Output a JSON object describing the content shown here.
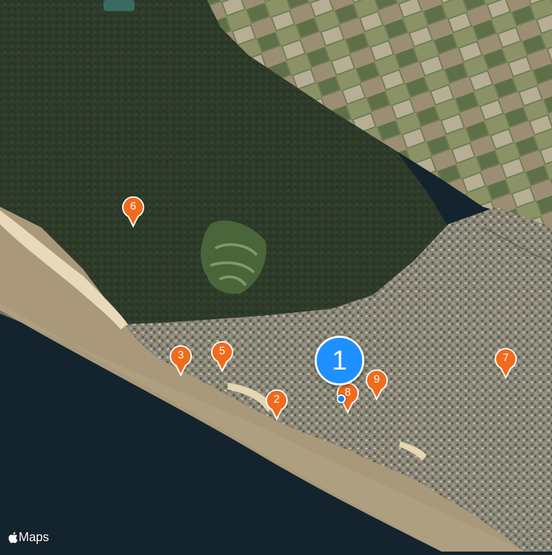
{
  "map": {
    "type": "satellite",
    "provider": "Apple Maps",
    "brand_label": "Maps",
    "selected_marker": {
      "label": "1",
      "color": "#1e90ff"
    },
    "markers": [
      {
        "id": "marker-2",
        "label": "2"
      },
      {
        "id": "marker-3",
        "label": "3"
      },
      {
        "id": "marker-5",
        "label": "5"
      },
      {
        "id": "marker-6",
        "label": "6"
      },
      {
        "id": "marker-7",
        "label": "7"
      },
      {
        "id": "marker-8",
        "label": "8"
      },
      {
        "id": "marker-9",
        "label": "9"
      }
    ],
    "marker_color": "#f26a1b",
    "colors": {
      "ocean": "#14242e",
      "estuary": "#a9997a",
      "forest": "#2e3b2a",
      "town": "#8c877c",
      "fields": "#7c8a5e",
      "beach": "#e8d9b8"
    }
  }
}
